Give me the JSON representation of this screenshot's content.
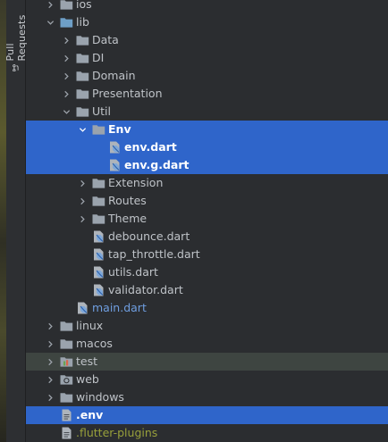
{
  "sidebar": {
    "pull_requests_label": "Pull Requests"
  },
  "tree": [
    {
      "name": "ios",
      "depth": 1,
      "type": "folder",
      "expandable": true,
      "expanded": false
    },
    {
      "name": "lib",
      "depth": 1,
      "type": "folder-src",
      "expandable": true,
      "expanded": true
    },
    {
      "name": "Data",
      "depth": 2,
      "type": "folder",
      "expandable": true,
      "expanded": false
    },
    {
      "name": "DI",
      "depth": 2,
      "type": "folder",
      "expandable": true,
      "expanded": false
    },
    {
      "name": "Domain",
      "depth": 2,
      "type": "folder",
      "expandable": true,
      "expanded": false
    },
    {
      "name": "Presentation",
      "depth": 2,
      "type": "folder",
      "expandable": true,
      "expanded": false
    },
    {
      "name": "Util",
      "depth": 2,
      "type": "folder",
      "expandable": true,
      "expanded": true
    },
    {
      "name": "Env",
      "depth": 3,
      "type": "folder",
      "expandable": true,
      "expanded": true,
      "selected": true,
      "bold": true
    },
    {
      "name": "env.dart",
      "depth": 4,
      "type": "dart",
      "selected": true,
      "bold": true
    },
    {
      "name": "env.g.dart",
      "depth": 4,
      "type": "dart",
      "selected": true,
      "bold": true
    },
    {
      "name": "Extension",
      "depth": 3,
      "type": "folder",
      "expandable": true,
      "expanded": false
    },
    {
      "name": "Routes",
      "depth": 3,
      "type": "folder",
      "expandable": true,
      "expanded": false
    },
    {
      "name": "Theme",
      "depth": 3,
      "type": "folder",
      "expandable": true,
      "expanded": false
    },
    {
      "name": "debounce.dart",
      "depth": 3,
      "type": "dart"
    },
    {
      "name": "tap_throttle.dart",
      "depth": 3,
      "type": "dart"
    },
    {
      "name": "utils.dart",
      "depth": 3,
      "type": "dart"
    },
    {
      "name": "validator.dart",
      "depth": 3,
      "type": "dart"
    },
    {
      "name": "main.dart",
      "depth": 2,
      "type": "dart",
      "color": "blue"
    },
    {
      "name": "linux",
      "depth": 1,
      "type": "folder",
      "expandable": true,
      "expanded": false
    },
    {
      "name": "macos",
      "depth": 1,
      "type": "folder",
      "expandable": true,
      "expanded": false
    },
    {
      "name": "test",
      "depth": 1,
      "type": "folder-test",
      "expandable": true,
      "expanded": false,
      "modified": true
    },
    {
      "name": "web",
      "depth": 1,
      "type": "folder-web",
      "expandable": true,
      "expanded": false
    },
    {
      "name": "windows",
      "depth": 1,
      "type": "folder",
      "expandable": true,
      "expanded": false
    },
    {
      "name": ".env",
      "depth": 1,
      "type": "file",
      "selected": true,
      "bold": true
    },
    {
      "name": ".flutter-plugins",
      "depth": 1,
      "type": "file",
      "color": "olive"
    }
  ],
  "colors": {
    "selection": "#2f65ca",
    "modified_row": "#3e4541",
    "folder": "#9aa3ad",
    "source_folder": "#6e9fc7",
    "dart_icon": "#7ea7d8"
  },
  "icons": {
    "collapsed": "chevron-right-icon",
    "expanded": "chevron-down-icon",
    "folder": "folder-icon",
    "dart": "dart-file-icon",
    "file": "text-file-icon"
  }
}
